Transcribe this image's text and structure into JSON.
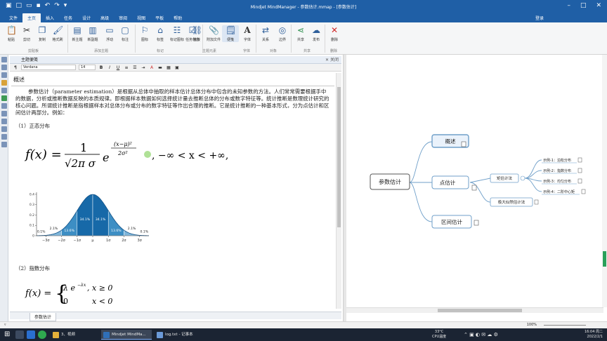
{
  "window": {
    "title": "Mindjet MindManager - 参数估计.mmap - [参数估计]",
    "login": "登录",
    "colors": {
      "titlebar": "#1f5fa6",
      "taskbar": "#1b2433"
    }
  },
  "menu": {
    "items": [
      "文件",
      "主页",
      "插入",
      "任务",
      "设计",
      "高级",
      "审阅",
      "视图",
      "平板",
      "帮助"
    ],
    "active_index": 1
  },
  "ribbon": {
    "buttons": [
      {
        "label": "粘贴",
        "icon": "paste-icon"
      },
      {
        "label": "剪切",
        "icon": "cut-icon"
      },
      {
        "label": "复制",
        "icon": "copy-icon"
      },
      {
        "label": "格式刷",
        "icon": "format-painter-icon"
      },
      {
        "label": "新主题",
        "icon": "new-topic-icon"
      },
      {
        "label": "新副题",
        "icon": "new-subtopic-icon"
      },
      {
        "label": "浮动",
        "icon": "floating-topic-icon"
      },
      {
        "label": "标注",
        "icon": "callout-icon"
      },
      {
        "label": "图标",
        "icon": "icon-marker-icon"
      },
      {
        "label": "标签",
        "icon": "tag-icon"
      },
      {
        "label": "标记图标",
        "icon": "marker-icon"
      },
      {
        "label": "任务信息",
        "icon": "task-info-icon"
      },
      {
        "label": "链接",
        "icon": "link-icon"
      },
      {
        "label": "附加文件",
        "icon": "attach-file-icon"
      },
      {
        "label": "便笺",
        "icon": "notes-icon"
      },
      {
        "label": "字体",
        "icon": "font-icon"
      },
      {
        "label": "关系",
        "icon": "relationship-icon"
      },
      {
        "label": "边界",
        "icon": "boundary-icon"
      },
      {
        "label": "共享",
        "icon": "share-icon"
      },
      {
        "label": "发布",
        "icon": "publish-icon"
      },
      {
        "label": "删除",
        "icon": "delete-icon"
      }
    ],
    "groups": [
      "剪贴板",
      "添加主题",
      "标记",
      "主题元素",
      "字体",
      "对象",
      "共享",
      "删除"
    ]
  },
  "notes_panel": {
    "title": "主题便笺",
    "close_label": "关闭",
    "font_name": "Verdana",
    "font_size": "14",
    "heading": "概述",
    "paragraph": "参数估计（parameter estimation）是根据从总体中抽取的样本估计总体分布中包含的未知参数的方法。人们常常需要根据手中的数据，分析或推断数据反映的本质规律。即根据样本数据如何选择统计量去推断总体的分布或数字特征等。统计推断是数理统计研究的核心问题。所谓统计推断是指根据样本对总体分布或分布的数字特征等作出合理的推断。它是统计推断的一种基本形式，分为点估计和区间估计两部分。例如：",
    "section1": "（1）正态分布",
    "section2": "（2）指数分布",
    "formula_normal": {
      "lhs": "f(x) =",
      "numerator": "1",
      "denominator": "√2π σ",
      "exp_base": "e",
      "exp_num": "(x−μ)²",
      "exp_den": "2σ²",
      "range": ", −∞ < x < +∞,"
    },
    "formula_exp": {
      "lhs": "f(x) =",
      "case1": "λ e",
      "case1_exp": "−λx",
      "case1_cond": ", x ≥ 0",
      "case2": "0",
      "case2_cond": "x < 0"
    },
    "bell_chart": {
      "percent_labels": [
        "0.1%",
        "2.1%",
        "13.6%",
        "34.1%",
        "34.1%",
        "13.6%",
        "2.1%",
        "0.1%"
      ],
      "x_ticks": [
        "−3σ",
        "−2σ",
        "−1σ",
        "μ",
        "1σ",
        "2σ",
        "3σ"
      ],
      "y_ticks": [
        "0",
        "0.1",
        "0.2",
        "0.3",
        "0.4"
      ]
    },
    "tab_label": "参数估计"
  },
  "mindmap": {
    "central": "参数估计",
    "topics": [
      {
        "label": "概述"
      },
      {
        "label": "点估计"
      },
      {
        "label": "区间估计"
      }
    ],
    "subtopics": [
      {
        "label": "矩估计法"
      },
      {
        "label": "极大似然估计法"
      }
    ],
    "leaves": [
      {
        "label": "示例-1：泊松分布"
      },
      {
        "label": "示例-2：指数分布"
      },
      {
        "label": "示例-3：均匀分布"
      },
      {
        "label": "示例-4：二阶中心矩"
      }
    ]
  },
  "statusbar": {
    "zoom": "100%"
  },
  "taskbar": {
    "items": [
      {
        "label": "3、视频",
        "color": "#e4b03a"
      },
      {
        "label": "Mindjet MindMa...",
        "color": "#2f6fb8"
      },
      {
        "label": "log.txt - 记事本",
        "color": "#6b9ad8"
      }
    ],
    "temperature": "33°C",
    "cpu_label": "CPU温度",
    "time": "16:04 周二",
    "date": "2022/2/1"
  }
}
